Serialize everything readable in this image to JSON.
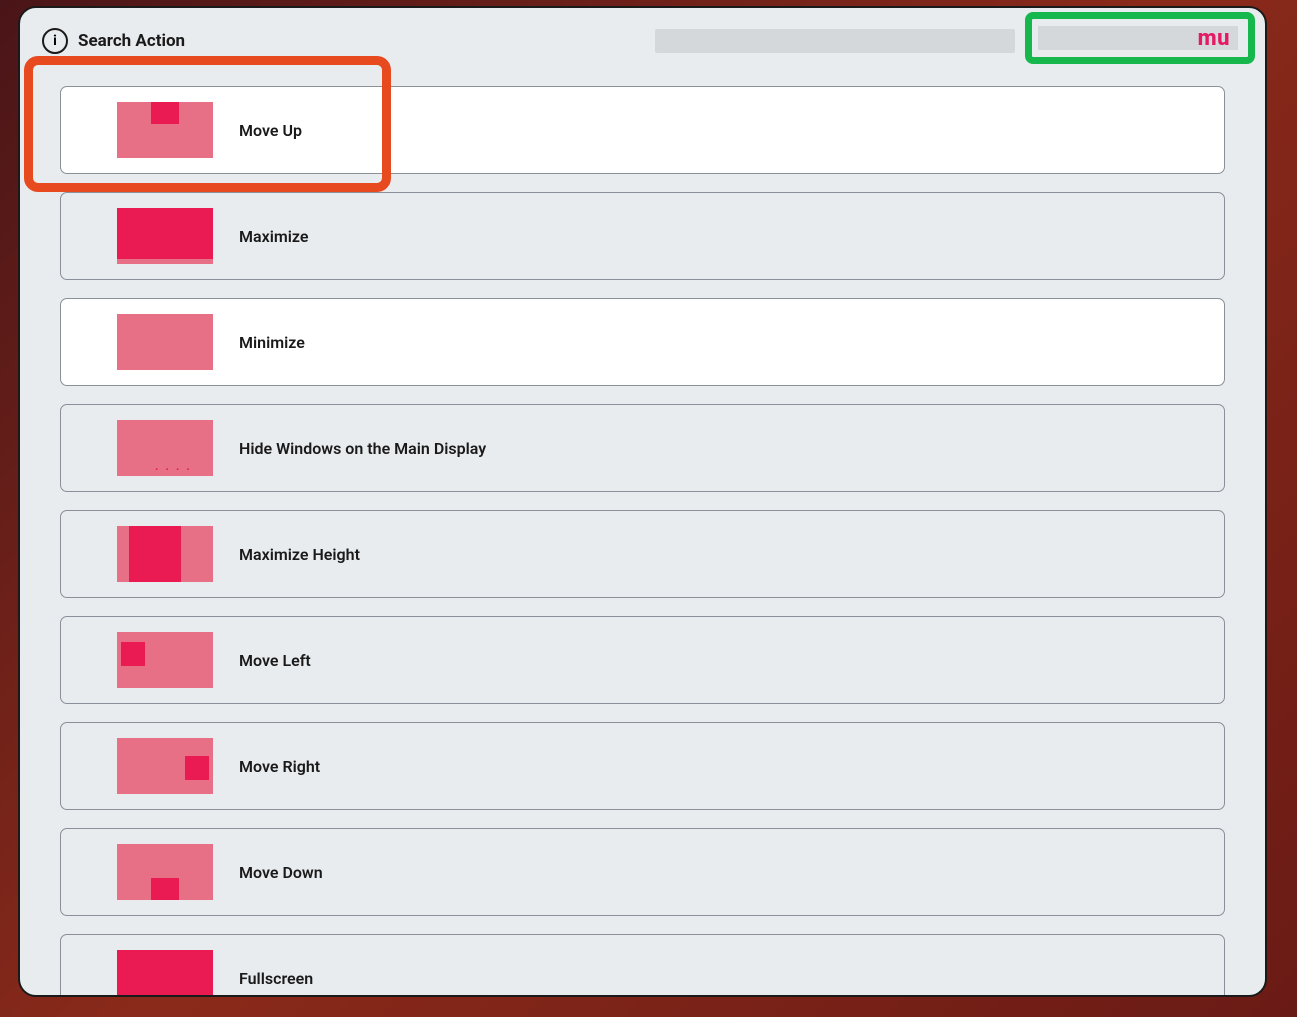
{
  "header": {
    "title": "Search Action",
    "search_value": "mu"
  },
  "items": [
    {
      "label": "Move Up",
      "highlighted": true,
      "white": true,
      "thumb": "move-up"
    },
    {
      "label": "Maximize",
      "highlighted": false,
      "white": false,
      "thumb": "maximize"
    },
    {
      "label": "Minimize",
      "highlighted": false,
      "white": true,
      "thumb": "minimize"
    },
    {
      "label": "Hide Windows on the Main Display",
      "highlighted": false,
      "white": false,
      "thumb": "hide"
    },
    {
      "label": "Maximize Height",
      "highlighted": false,
      "white": false,
      "thumb": "max-height"
    },
    {
      "label": "Move Left",
      "highlighted": false,
      "white": false,
      "thumb": "move-left"
    },
    {
      "label": "Move Right",
      "highlighted": false,
      "white": false,
      "thumb": "move-right"
    },
    {
      "label": "Move Down",
      "highlighted": false,
      "white": false,
      "thumb": "move-down"
    },
    {
      "label": "Fullscreen",
      "highlighted": false,
      "white": false,
      "thumb": "fullscreen"
    }
  ]
}
